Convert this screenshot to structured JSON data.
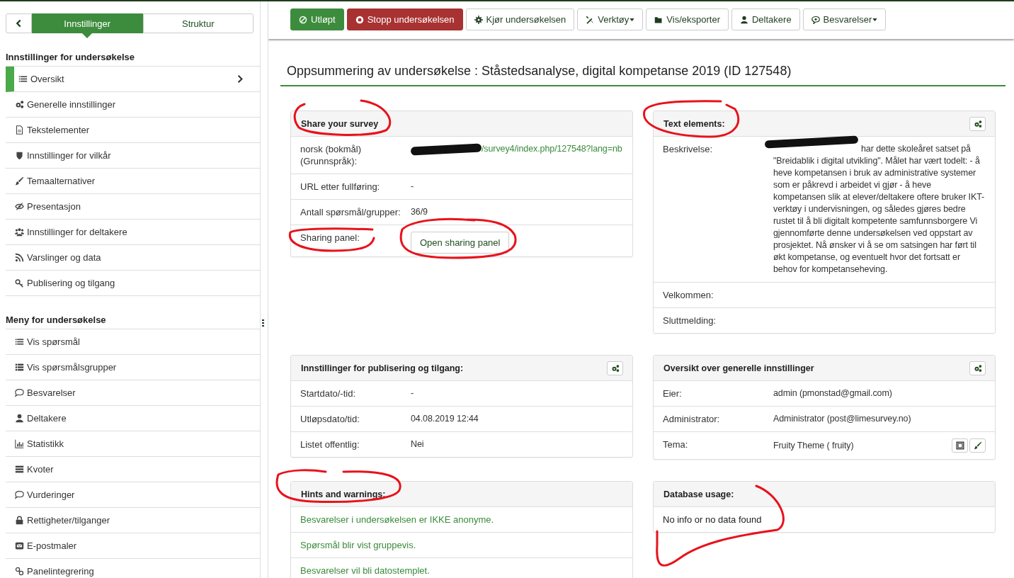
{
  "sidebar": {
    "tabs": [
      {
        "label": "Innstillinger",
        "selected": true
      },
      {
        "label": "Struktur",
        "selected": false
      }
    ],
    "sections": [
      {
        "heading": "Innstillinger for undersøkelse",
        "items": [
          {
            "label": "Oversikt",
            "selected": true
          },
          {
            "label": "Generelle innstillinger",
            "selected": false
          },
          {
            "label": "Tekstelementer",
            "selected": false
          },
          {
            "label": "Innstillinger for vilkår",
            "selected": false
          },
          {
            "label": "Temaalternativer",
            "selected": false
          },
          {
            "label": "Presentasjon",
            "selected": false
          },
          {
            "label": "Innstillinger for deltakere",
            "selected": false
          },
          {
            "label": "Varslinger og data",
            "selected": false
          },
          {
            "label": "Publisering og tilgang",
            "selected": false
          }
        ]
      },
      {
        "heading": "Meny for undersøkelse",
        "items": [
          {
            "label": "Vis spørsmål",
            "selected": false
          },
          {
            "label": "Vis spørsmålsgrupper",
            "selected": false
          },
          {
            "label": "Besvarelser",
            "selected": false
          },
          {
            "label": "Deltakere",
            "selected": false
          },
          {
            "label": "Statistikk",
            "selected": false
          },
          {
            "label": "Kvoter",
            "selected": false
          },
          {
            "label": "Vurderinger",
            "selected": false
          },
          {
            "label": "Rettigheter/tilganger",
            "selected": false
          },
          {
            "label": "E-postmaler",
            "selected": false
          },
          {
            "label": "Panelintegrering",
            "selected": false
          }
        ]
      }
    ]
  },
  "toolbar": [
    {
      "label": "Utløpt",
      "kind": "success",
      "dropdown": false
    },
    {
      "label": "Stopp undersøkelsen",
      "kind": "danger",
      "dropdown": false
    },
    {
      "label": "Kjør undersøkelsen",
      "kind": "default",
      "dropdown": false
    },
    {
      "label": "Verktøy",
      "kind": "default",
      "dropdown": true
    },
    {
      "label": "Vis/eksporter",
      "kind": "default",
      "dropdown": false
    },
    {
      "label": "Deltakere",
      "kind": "default",
      "dropdown": false
    },
    {
      "label": "Besvarelser",
      "kind": "default",
      "dropdown": true
    }
  ],
  "title": "Oppsummering av undersøkelse : Ståstedsanalyse, digital kompetanse 2019 (ID 127548)",
  "panels": [
    {
      "title": "Share your survey",
      "settings": false,
      "rows": [
        {
          "kind": "link",
          "label": "norsk (bokmål) (Grunnspråk):",
          "value": "/survey4/index.php/127548?lang=nb",
          "redacted": true
        },
        {
          "kind": "text",
          "label": "URL etter fullføring:",
          "value": "-"
        },
        {
          "kind": "text",
          "label": "Antall spørsmål/grupper:",
          "value": "36/9"
        },
        {
          "kind": "button",
          "label": "Sharing panel:",
          "value": "Open sharing panel"
        }
      ]
    },
    {
      "title": "Text elements:",
      "settings": true,
      "rows": [
        {
          "kind": "text",
          "label": "Beskrivelse:",
          "value": "har dette skoleåret satset på \"Breidablik i digital utvikling\". Målet har vært todelt: - å heve kompetansen i bruk av administrative systemer som er påkrevd i arbeidet vi gjør - å heve kompetansen slik at elever/deltakere oftere bruker IKT-verktøy i undervisningen, og således gjøres bedre rustet til å bli digitalt kompetente samfunnsborgere Vi gjennomførte denne undersøkelsen ved oppstart av prosjektet. Nå ønsker vi å se om satsingen har ført til økt kompetanse, og eventuelt hvor det fortsatt er behov for kompetanseheving.",
          "redacted": true
        },
        {
          "kind": "text",
          "label": "Velkommen:"
        },
        {
          "kind": "text",
          "label": "Sluttmelding:"
        }
      ]
    },
    {
      "title": "Innstillinger for publisering og tilgang:",
      "settings": true,
      "rows": [
        {
          "kind": "text",
          "label": "Startdato/-tid:",
          "value": "-"
        },
        {
          "kind": "text",
          "label": "Utløpsdato/tid:",
          "value": "04.08.2019 12:44"
        },
        {
          "kind": "text",
          "label": "Listet offentlig:",
          "value": "Nei"
        }
      ]
    },
    {
      "title": "Oversikt over generelle innstillinger",
      "settings": true,
      "rows": [
        {
          "kind": "text",
          "label": "Eier:",
          "value": "admin (pmonstad@gmail.com)"
        },
        {
          "kind": "text",
          "label": "Administrator:",
          "value": "Administrator (post@limesurvey.no)"
        },
        {
          "kind": "theme",
          "label": "Tema:",
          "value": "Fruity Theme ( fruity)"
        }
      ]
    },
    {
      "title": "Hints and warnings:",
      "settings": false,
      "rows": [
        {
          "kind": "hint",
          "value": "Besvarelser i undersøkelsen er IKKE anonyme."
        },
        {
          "kind": "hint",
          "value": "Spørsmål blir vist gruppevis."
        },
        {
          "kind": "hint",
          "value": "Besvarelser vil bli datostemplet."
        }
      ]
    },
    {
      "title": "Database usage:",
      "settings": false,
      "rows": [
        {
          "kind": "plain",
          "value": "No info or no data found"
        }
      ]
    }
  ]
}
